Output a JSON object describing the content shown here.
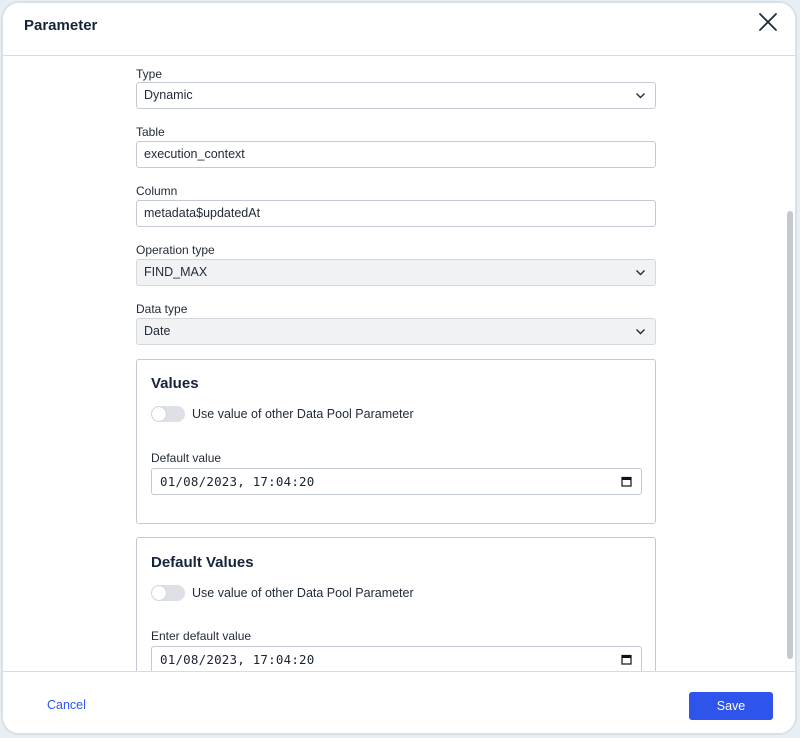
{
  "dialog": {
    "title": "Parameter",
    "close_icon": "close-icon"
  },
  "form": {
    "type": {
      "label": "Type",
      "value": "Dynamic"
    },
    "table": {
      "label": "Table",
      "value": "execution_context"
    },
    "column": {
      "label": "Column",
      "value": "metadata$updatedAt"
    },
    "operation_type": {
      "label": "Operation type",
      "value": "FIND_MAX"
    },
    "data_type": {
      "label": "Data type",
      "value": "Date"
    }
  },
  "values_card": {
    "title": "Values",
    "toggle_label": "Use value of other Data Pool Parameter",
    "toggle_on": false,
    "default_label": "Default value",
    "default_value": "01/08/2023, 17:04:20"
  },
  "default_values_card": {
    "title": "Default Values",
    "toggle_label": "Use value of other Data Pool Parameter",
    "toggle_on": false,
    "default_label": "Enter default value",
    "default_value": "01/08/2023, 17:04:20"
  },
  "footer": {
    "cancel_label": "Cancel",
    "save_label": "Save"
  },
  "colors": {
    "accent": "#2f54eb",
    "border": "#c3cad3",
    "readonly_bg": "#f1f2f4"
  }
}
